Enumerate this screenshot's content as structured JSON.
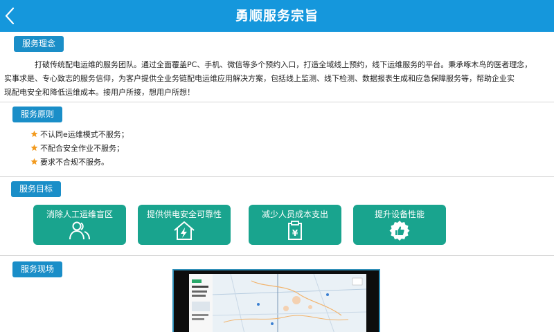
{
  "header": {
    "title": "勇顺服务宗旨",
    "back_icon": "chevron-left-icon"
  },
  "colors": {
    "header_bg": "#1597dc",
    "tag_bg": "#1a8ec8",
    "goal_bg": "#19a48e",
    "star": "#f29a1e"
  },
  "philosophy": {
    "title": "服务理念",
    "line1": "打破传统配电运维的服务团队。通过全面覆盖PC、手机、微信等多个预约入口，打造全域线上预约，线下运维服务的平台。秉承啄木鸟的医者理念，",
    "line2": "实事求是、专心致志的服务信仰，为客户提供全业务链配电运维应用解决方案，包括线上监测、线下检测、数据报表生成和应急保障服务等，帮助企业实",
    "line3": "现配电安全和降低运维成本。接用户所接，想用户所想！"
  },
  "principles": {
    "title": "服务原则",
    "items": [
      "不认同e运维模式不服务；",
      "不配合安全作业不服务；",
      "要求不合规不服务。"
    ]
  },
  "goals": {
    "title": "服务目标",
    "items": [
      {
        "label": "消除人工运维盲区",
        "icon": "people-icon"
      },
      {
        "label": "提供供电安全可靠性",
        "icon": "house-bolt-icon"
      },
      {
        "label": "减少人员成本支出",
        "icon": "yen-document-icon"
      },
      {
        "label": "提升设备性能",
        "icon": "thumbs-up-badge-icon"
      }
    ]
  },
  "site": {
    "title": "服务现场",
    "photo": "monitoring-screen-photo"
  }
}
